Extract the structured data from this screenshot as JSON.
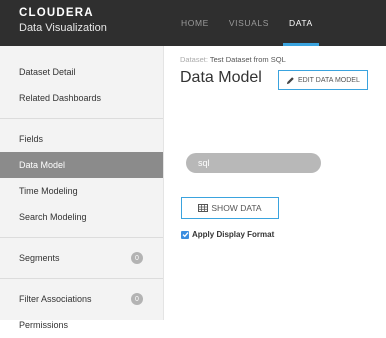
{
  "brand": {
    "name": "CLOUDERA",
    "product": "Data Visualization"
  },
  "nav": {
    "tabs": [
      {
        "label": "HOME"
      },
      {
        "label": "VISUALS"
      },
      {
        "label": "DATA"
      }
    ],
    "active": "DATA"
  },
  "sidebar": {
    "items": [
      {
        "label": "Dataset Detail"
      },
      {
        "label": "Related Dashboards"
      },
      {
        "label": "Fields"
      },
      {
        "label": "Data Model"
      },
      {
        "label": "Time Modeling"
      },
      {
        "label": "Search Modeling"
      },
      {
        "label": "Segments",
        "badge": "0"
      },
      {
        "label": "Filter Associations",
        "badge": "0"
      },
      {
        "label": "Permissions"
      }
    ],
    "active_item": "Data Model"
  },
  "main": {
    "breadcrumb_label": "Dataset:",
    "breadcrumb_value": "Test Dataset from SQL",
    "title": "Data Model",
    "edit_button": "EDIT DATA MODEL",
    "sql_table": "sql",
    "show_data_button": "SHOW DATA",
    "apply_format_label": "Apply Display Format",
    "apply_format_checked": true
  },
  "colors": {
    "accent": "#3aa3de",
    "topbar": "#2f2f2f",
    "active_sidebar": "#8b8b8b"
  },
  "icons": {
    "edit": "pencil-icon",
    "show_data": "table-icon",
    "checkbox": "checkbox-checked-icon"
  }
}
